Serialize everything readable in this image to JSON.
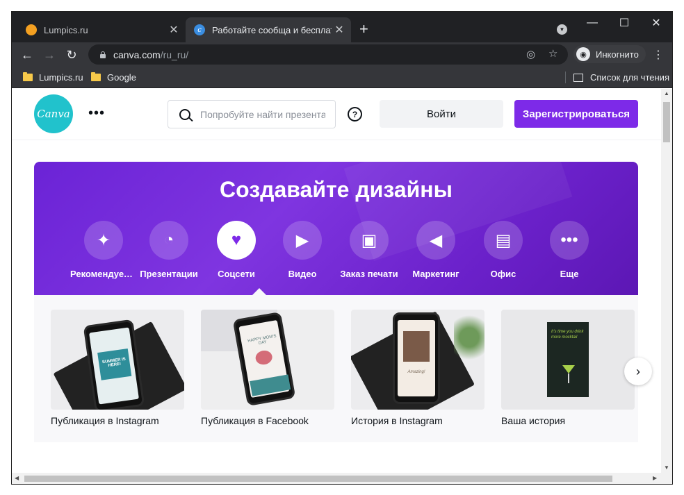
{
  "browser": {
    "tabs": [
      {
        "title": "Lumpics.ru",
        "favicon": "orange-circle-icon"
      },
      {
        "title": "Работайте сообща и бесплатно",
        "favicon": "canva-icon"
      }
    ],
    "url_host": "canva.com",
    "url_path": "/ru_ru/",
    "incognito_label": "Инкогнито",
    "bookmarks": [
      {
        "label": "Lumpics.ru"
      },
      {
        "label": "Google"
      }
    ],
    "reading_list": "Список для чтения"
  },
  "canva": {
    "logo_text": "Canva",
    "search_placeholder": "Попробуйте найти презентации",
    "help": "?",
    "login": "Войти",
    "signup": "Зарегистрироваться",
    "hero_title": "Создавайте дизайны",
    "categories": [
      {
        "label": "Рекомендуемое",
        "icon": "sparkle-icon"
      },
      {
        "label": "Презентации",
        "icon": "presentation-icon"
      },
      {
        "label": "Соцсети",
        "icon": "heart-bubble-icon"
      },
      {
        "label": "Видео",
        "icon": "video-camera-icon"
      },
      {
        "label": "Заказ печати",
        "icon": "print-order-icon"
      },
      {
        "label": "Маркетинг",
        "icon": "megaphone-icon"
      },
      {
        "label": "Офис",
        "icon": "briefcase-icon"
      },
      {
        "label": "Еще",
        "icon": "more-dots-icon"
      }
    ],
    "active_category": "Соцсети",
    "templates": [
      {
        "label": "Публикация в Instagram"
      },
      {
        "label": "Публикация в Facebook"
      },
      {
        "label": "История в Instagram"
      },
      {
        "label": "Ваша история"
      }
    ],
    "thumbs": {
      "summer": "SUMMER IS HERE!",
      "happy": "HAPPY MOM'S DAY",
      "story_note": "Amazing!",
      "cocktail": "It's time you drink more mocktail"
    }
  }
}
